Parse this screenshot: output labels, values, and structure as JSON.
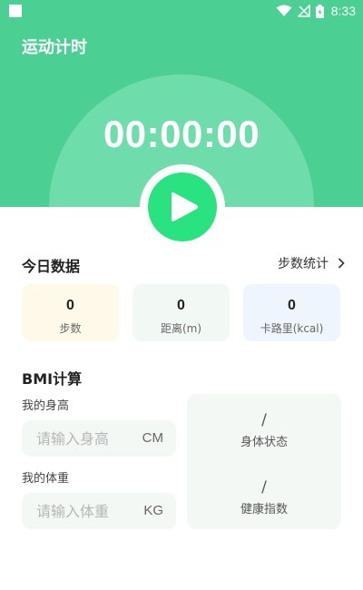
{
  "status_bar": {
    "time": "8:33",
    "icons": [
      "app-square-icon",
      "wifi-icon",
      "no-signal-icon",
      "battery-icon"
    ]
  },
  "header": {
    "title": "运动计时",
    "timer": "00:00:00",
    "play_icon": "play-icon"
  },
  "today": {
    "title": "今日数据",
    "link_label": "步数统计",
    "cards": [
      {
        "value": "0",
        "label": "步数",
        "color": "#fff9ea"
      },
      {
        "value": "0",
        "label": "距离(m)",
        "color": "#f2f8f4"
      },
      {
        "value": "0",
        "label": "卡路里(kcal)",
        "color": "#eef5fc"
      }
    ]
  },
  "bmi": {
    "title": "BMI计算",
    "height_label": "我的身高",
    "height_placeholder": "请输入身高",
    "height_unit": "CM",
    "weight_label": "我的体重",
    "weight_placeholder": "请输入体重",
    "weight_unit": "KG",
    "status_value": "/",
    "status_label": "身体状态",
    "index_value": "/",
    "index_label": "健康指数"
  },
  "colors": {
    "header_green": "#4ccf93",
    "disc_green": "#6fdcab",
    "play_green": "#28e37f",
    "field_bg": "#f3f8f4"
  }
}
